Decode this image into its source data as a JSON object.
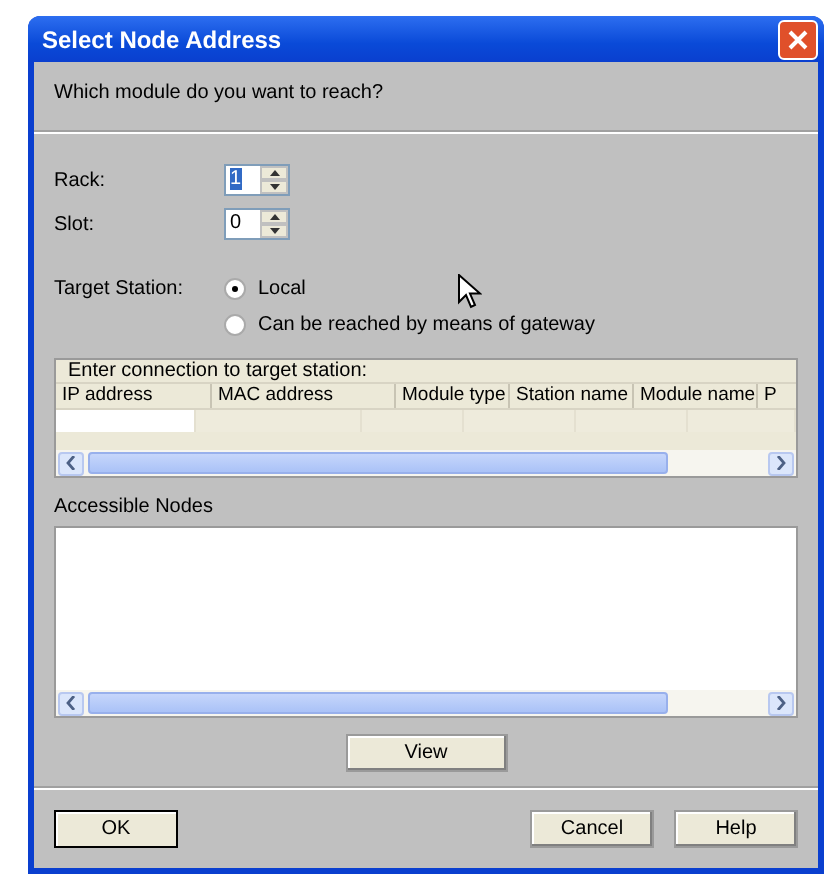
{
  "window": {
    "title": "Select Node Address"
  },
  "prompt": "Which module do you want to reach?",
  "fields": [
    {
      "label": "Rack:",
      "value": "1",
      "highlighted": true
    },
    {
      "label": "Slot:",
      "value": "0",
      "highlighted": false
    }
  ],
  "target_station": {
    "label": "Target Station:",
    "options": [
      {
        "label": "Local",
        "selected": true
      },
      {
        "label": "Can be reached by means of gateway",
        "selected": false
      }
    ]
  },
  "connection_table": {
    "caption": "Enter connection to target station:",
    "columns": [
      "IP address",
      "MAC address",
      "Module type",
      "Station name",
      "Module name",
      "P"
    ]
  },
  "accessible_nodes": {
    "label": "Accessible Nodes"
  },
  "view_button": "View",
  "footer_buttons": [
    {
      "label": "OK",
      "default": true
    },
    {
      "label": "Cancel",
      "default": false
    },
    {
      "label": "Help",
      "default": false
    }
  ]
}
